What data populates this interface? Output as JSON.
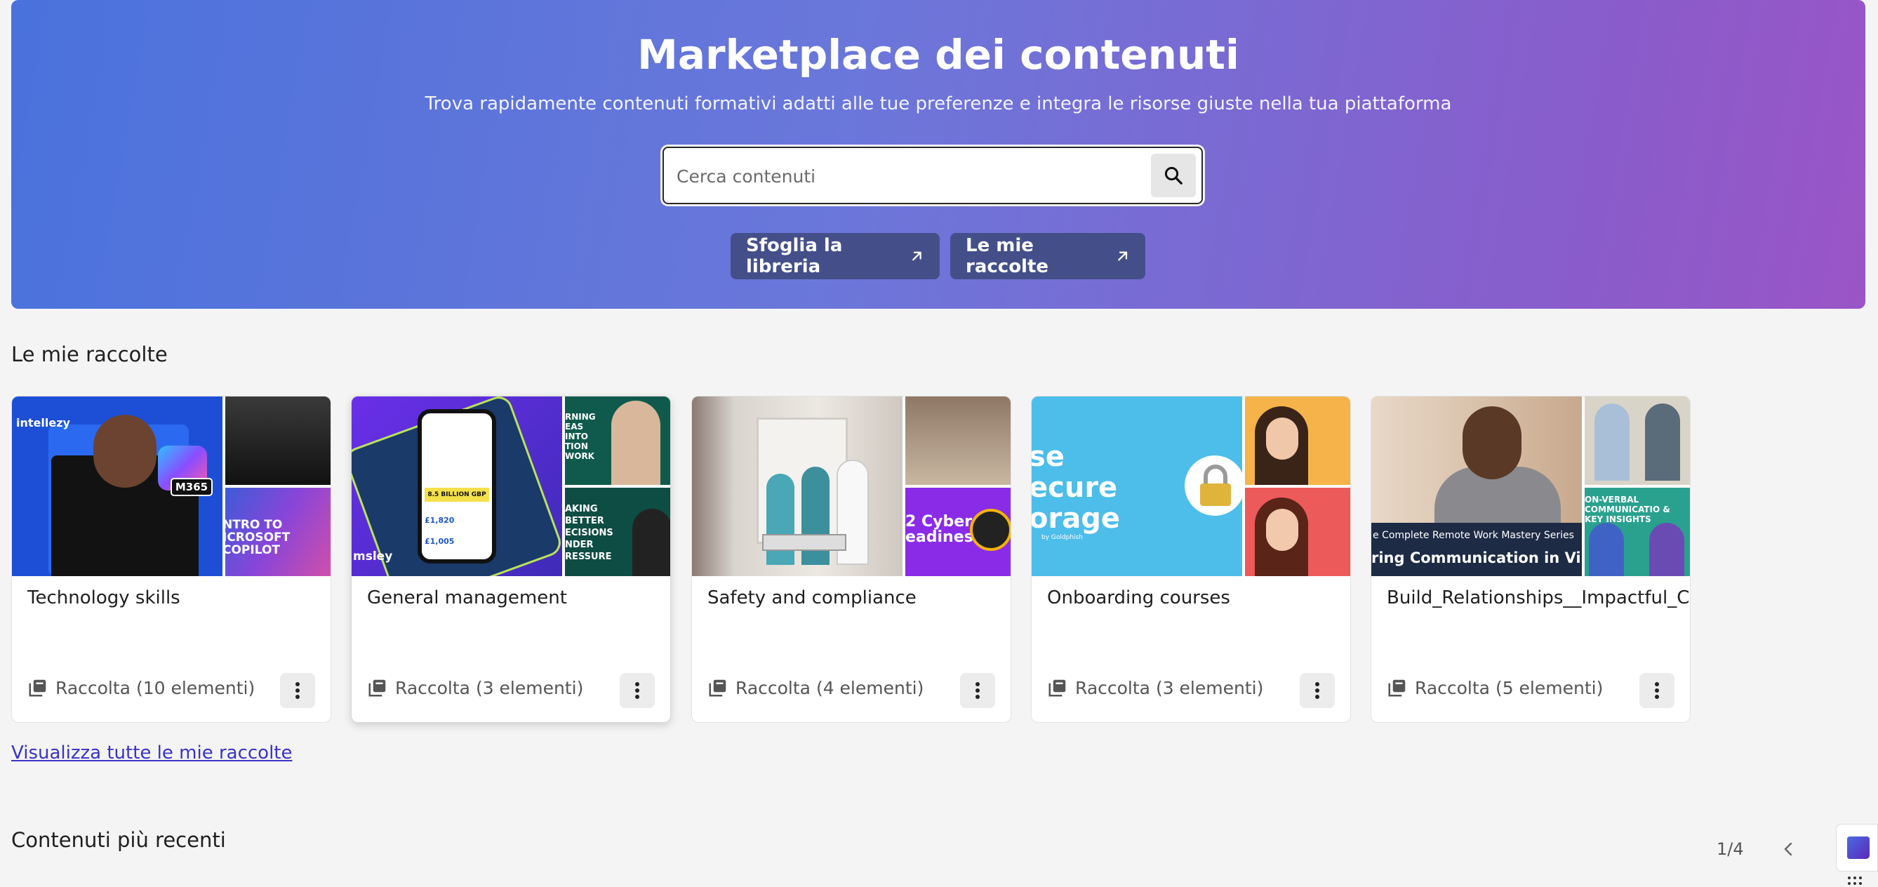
{
  "hero": {
    "title": "Marketplace dei contenuti",
    "subtitle": "Trova rapidamente contenuti formativi adatti alle tue preferenze e integra le risorse giuste nella tua piattaforma",
    "search_placeholder": "Cerca contenuti",
    "buttons": [
      {
        "label": "Sfoglia la libreria",
        "icon": "arrow-up-right-icon"
      },
      {
        "label": "Le mie raccolte",
        "icon": "arrow-up-right-icon"
      }
    ],
    "gradient_start": "#4a72dc",
    "gradient_end": "#9a55c6"
  },
  "collections": {
    "title": "Le mie raccolte",
    "view_all": "Visualizza tutte le mie raccolte",
    "items": [
      {
        "title": "Technology skills",
        "meta": "Raccolta (10 elementi)",
        "thumb_texts": [
          "intellezy",
          "M365",
          "NTRO TO ICROSOFT COPILOT"
        ]
      },
      {
        "title": "General management",
        "meta": "Raccolta (3 elementi)",
        "thumb_texts": [
          "8.5 BILLION GBP",
          "£1,820",
          "£1,005",
          "msley",
          "RNING EAS INTO TION WORK",
          "AKING BETTER ECISIONS NDER RESSURE"
        ]
      },
      {
        "title": "Safety and compliance",
        "meta": "Raccolta (4 elementi)",
        "thumb_texts": [
          "2 Cyber eadiness"
        ]
      },
      {
        "title": "Onboarding courses",
        "meta": "Raccolta (3 elementi)",
        "thumb_texts": [
          "se ecure orage",
          "by Goldphish"
        ]
      },
      {
        "title": "Build_Relationships__Impactful_Com",
        "meta": "Raccolta (5 elementi)",
        "thumb_texts": [
          "e Complete Remote Work Mastery Series",
          "ring Communication in Virtual T",
          "ON-VERBAL COMMUNICATIO & KEY INSIGHTS"
        ]
      }
    ]
  },
  "recent": {
    "title": "Contenuti più recenti",
    "pager": "1/4"
  }
}
